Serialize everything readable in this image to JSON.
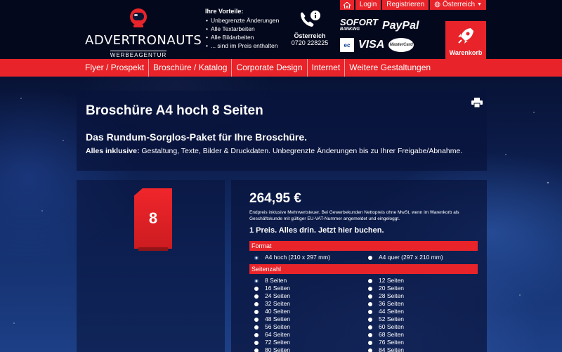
{
  "topbar": {
    "login": "Login",
    "register": "Registrieren",
    "country": "Österreich"
  },
  "logo": {
    "brand": "ADVERTRONAUTS",
    "sub": "WERBEAGENTUR"
  },
  "vorteile": {
    "title": "Ihre Vorteile:",
    "items": [
      "Unbegrenzte Änderungen",
      "Alle Textarbeiten",
      "Alle Bildarbeiten",
      "... sind im Preis enthalten"
    ]
  },
  "contact": {
    "country": "Österreich",
    "phone": "0720 228225"
  },
  "payments": {
    "sofort": "SOFORT",
    "sofort_sub": "BANKING",
    "paypal": "PayPal",
    "ec": "ec",
    "visa": "VISA",
    "mastercard": "MasterCard"
  },
  "cart": {
    "label": "Warenkorb"
  },
  "nav": [
    "Flyer / Prospekt",
    "Broschüre / Katalog",
    "Corporate Design",
    "Internet",
    "Weitere Gestaltungen"
  ],
  "page": {
    "title": "Broschüre A4 hoch 8 Seiten",
    "subtitle": "Das Rundum-Sorglos-Paket für Ihre Broschüre.",
    "intro_bold": "Alles inklusive:",
    "intro_text": " Gestaltung, Texte, Bilder & Druckdaten. Unbegrenzte Änderungen bis zu Ihrer Freigabe/Abnahme."
  },
  "product": {
    "pages_badge": "8"
  },
  "order": {
    "price": "264,95 €",
    "price_note": "Endpreis inklusive Mehrwertsteuer. Bei Gewerbekunden Nettopreis ohne MwSt, wenn im Warenkorb als Geschäftskunde mit gültiger EU-VAT-Nummer angemeldet und eingeloggt.",
    "cta": "1 Preis. Alles drin. Jetzt hier buchen.",
    "format_label": "Format",
    "format_options": [
      "A4 hoch (210 x 297 mm)",
      "A4 quer (297 x 210 mm)"
    ],
    "format_selected": 0,
    "pages_label": "Seitenzahl",
    "pages_options": [
      "8 Seiten",
      "12 Seiten",
      "16 Seiten",
      "20 Seiten",
      "24 Seiten",
      "28 Seiten",
      "32 Seiten",
      "36 Seiten",
      "40 Seiten",
      "44 Seiten",
      "48 Seiten",
      "52 Seiten",
      "56 Seiten",
      "60 Seiten",
      "64 Seiten",
      "68 Seiten",
      "72 Seiten",
      "76 Seiten",
      "80 Seiten",
      "84 Seiten"
    ],
    "pages_selected": 0
  },
  "colors": {
    "accent": "#e8242a",
    "panel": "#08143c"
  }
}
